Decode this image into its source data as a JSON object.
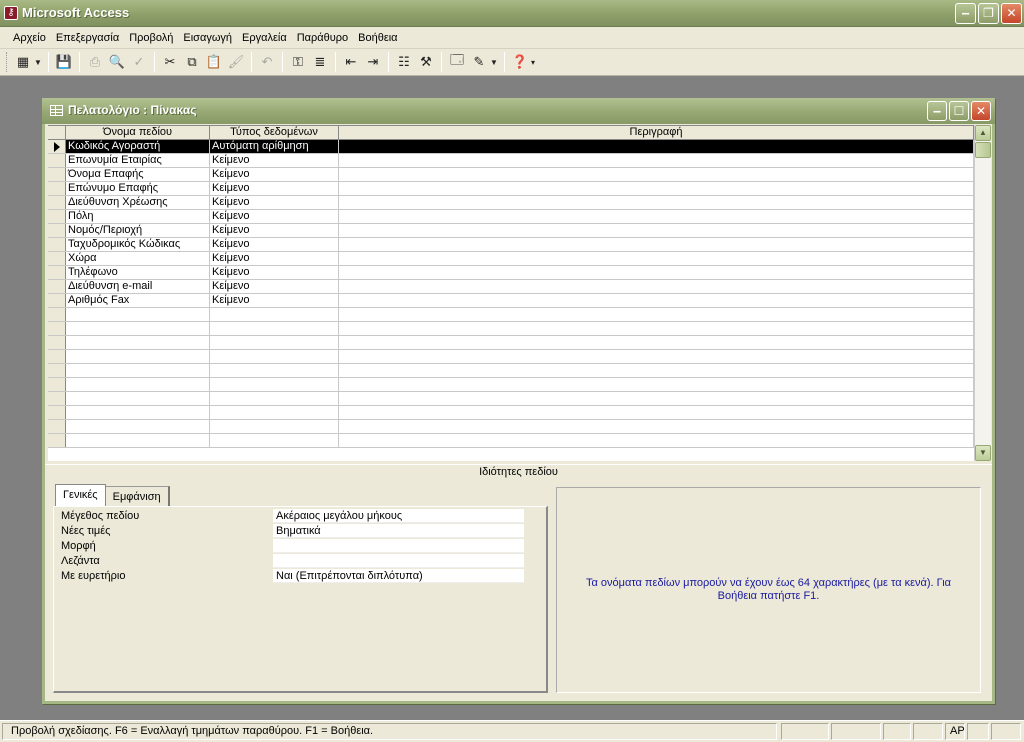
{
  "app": {
    "title": "Microsoft Access"
  },
  "menu": [
    "Αρχείο",
    "Επεξεργασία",
    "Προβολή",
    "Εισαγωγή",
    "Εργαλεία",
    "Παράθυρο",
    "Βοήθεια"
  ],
  "child": {
    "title": "Πελατολόγιο : Πίνακας",
    "columns": {
      "field_name": "Όνομα πεδίου",
      "data_type": "Τύπος δεδομένων",
      "description": "Περιγραφή"
    },
    "fields": [
      {
        "name": "Κωδικός Αγοραστή",
        "type": "Αυτόματη αρίθμηση",
        "desc": ""
      },
      {
        "name": "Επωνυμία Εταιρίας",
        "type": "Κείμενο",
        "desc": ""
      },
      {
        "name": "Όνομα Επαφής",
        "type": "Κείμενο",
        "desc": ""
      },
      {
        "name": "Επώνυμο Επαφής",
        "type": "Κείμενο",
        "desc": ""
      },
      {
        "name": "Διεύθυνση Χρέωσης",
        "type": "Κείμενο",
        "desc": ""
      },
      {
        "name": "Πόλη",
        "type": "Κείμενο",
        "desc": ""
      },
      {
        "name": "Νομός/Περιοχή",
        "type": "Κείμενο",
        "desc": ""
      },
      {
        "name": "Ταχυδρομικός Κώδικας",
        "type": "Κείμενο",
        "desc": ""
      },
      {
        "name": "Χώρα",
        "type": "Κείμενο",
        "desc": ""
      },
      {
        "name": "Τηλέφωνο",
        "type": "Κείμενο",
        "desc": ""
      },
      {
        "name": "Διεύθυνση e-mail",
        "type": "Κείμενο",
        "desc": ""
      },
      {
        "name": "Αριθμός Fax",
        "type": "Κείμενο",
        "desc": ""
      }
    ],
    "properties_header": "Ιδιότητες πεδίου",
    "tabs": {
      "general": "Γενικές",
      "appearance": "Εμφάνιση"
    },
    "properties": [
      {
        "label": "Μέγεθος πεδίου",
        "value": "Ακέραιος μεγάλου μήκους"
      },
      {
        "label": "Νέες τιμές",
        "value": "Βηματικά"
      },
      {
        "label": "Μορφή",
        "value": ""
      },
      {
        "label": "Λεζάντα",
        "value": ""
      },
      {
        "label": "Με ευρετήριο",
        "value": "Ναι (Επιτρέπονται διπλότυπα)"
      }
    ],
    "hint": "Τα ονόματα πεδίων μπορούν να έχουν έως 64 χαρακτήρες (με τα κενά). Για Βοήθεια πατήστε F1."
  },
  "status": {
    "text": "Προβολή σχεδίασης. F6 = Εναλλαγή τμημάτων παραθύρου.  F1 = Βοήθεια.",
    "lang": "ΑΡ"
  }
}
